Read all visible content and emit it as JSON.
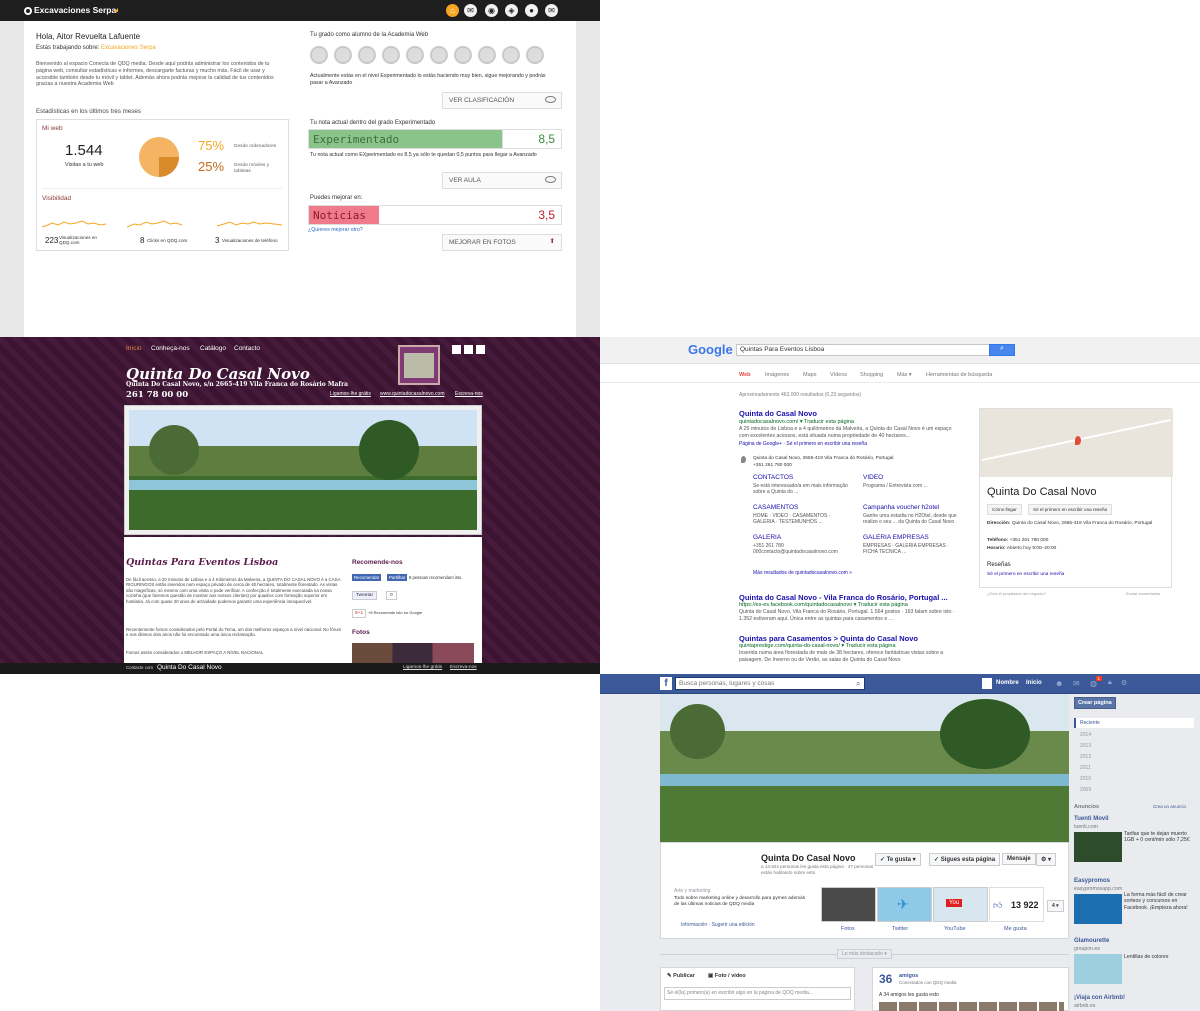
{
  "dash": {
    "brand": "Excavaciones Serpa",
    "greeting": "Hola, Aitor Revuelta Lafuente",
    "working_label": "Estás trabajando sobre:",
    "working_name": "Excavaciones Serpa",
    "intro": "Bienvenido al espacio Conecta de QDQ media. Desde aquí podrás administrar los contenidos de tu página web, consultar estadísticas e informes, descargarte facturas y mucho más. Fácil de usar y accesible también desde tu móvil y tablet. Además ahora podrás mejorar la calidad de tus contenidos gracias a nuestra Academia Web",
    "stats_title": "Estadísticas en los últimos tres meses",
    "my_web": "Mi web",
    "visits_value": "1.544",
    "visits_label": "Visitas a tu web",
    "pct_desktop": "75%",
    "pct_desktop_label": "Desde ordenadores",
    "pct_mobile": "25%",
    "pct_mobile_label": "Desde móviles y tabletas",
    "desktop_fraction": 0.75,
    "visibility": "Visibilidad",
    "vis_qdq_value": "223",
    "vis_qdq_label": "Visualizaciones en QDQ.com",
    "clicks_value": "8",
    "clicks_label": "Clicks en QDQ.com",
    "phone_views_value": "3",
    "phone_views_label": "Visualizaciones de teléfono",
    "academy_title": "Tu grado como alumno de la Academia Web",
    "academy_text": "Actualmente estás en el nivel Experimentado lo estás haciendo muy bien, sigue mejorando y podrás pasar a Avanzado",
    "ranking_btn": "VER CLASIFICACIÓN",
    "grade_title": "Tu nota actual dentro del grado Experimentado",
    "grade_label": "Experimentado",
    "grade_value": "8,5",
    "grade_fraction": 0.85,
    "grade_text": "Tu nota actual como EXperimentado es 8,5 ya sólo te quedan 0,5 puntos para llegar a Avanzado",
    "classroom_btn": "VER AULA",
    "improve_title": "Puedes mejorar en:",
    "improve_label": "Noticias",
    "improve_value": "3,5",
    "improve_fraction": 0.35,
    "improve_link": "¿Quieres mejorar otro?",
    "improve_btn": "MEJORAR EN FOTOS",
    "colors": {
      "green": "#8bc48a",
      "red": "#f07a8a",
      "orange": "#f5a623"
    }
  },
  "site": {
    "nav": [
      "Início",
      "Conheça-nos",
      "Catálogo",
      "Contacto"
    ],
    "title": "Quinta Do Casal Novo",
    "address": "Quinta Do Casal Novo, s/n  2665-419  Vila Franca do Rosário Mafra",
    "phone": "261 78 00 00",
    "links": [
      "Ligamos-lhe grátis",
      "www.quintadocasalnovo.com",
      "Escreva-nos"
    ],
    "heading": "Quintas Para Eventos Lisboa",
    "body1": "De fácil acesso, a 20 minutos de Lisboa e a 4 Kilómetros da Malveira, a QUINTA DO CASAL NOVO é a CASA RIGURINGOS estão inseridos num espaço privado de cerca de 40 hectares, totalmente florestado. As vistas são magníficas, só mesmo com uma visita o pode verificar. A confecção é totalmente executada na nossa cozinha (que fazemos questão de mostrar aos nossos clientes) por quadros com formação superior em hotelaria. Já com quase 20 anos de actividade podemos garantir uma experiência inesquecível.",
    "body2": "Recentemente fomos considerados pelo Portal do Tema, um dos melhores espaços a nível nacional. No fórum e nos últimos dois anos não foi encontrado uma única reclamação.",
    "body3": "Fomos assim considerados o MELHOR ESPAÇO A NÍVEL NACIONAL",
    "recommend_title": "Recomende-nos",
    "fb_recommend": "Recomendar",
    "fb_share": "Partilhar",
    "fb_count_text": "8 pessoas recomendam isto.",
    "tweet": "Tweetar",
    "tweet_count": "0",
    "gplus": "8+1",
    "gplus_text": "+8 Recomende isto no Google",
    "photos_title": "Fotos",
    "footer_left": "Contacte com",
    "footer_name": "Quinta Do Casal Novo",
    "footer_links": [
      "Ligamos-lhe grátis",
      "Escreva-nos"
    ]
  },
  "google": {
    "logo": "Google",
    "query": "Quintas Para Eventos Lisboa",
    "tabs": [
      "Web",
      "Imágenes",
      "Maps",
      "Vídeos",
      "Shopping",
      "Más ▾",
      "Herramientas de búsqueda"
    ],
    "results_count": "Aproximadamente 463.000 resultados (0,23 segundos)",
    "r1_title": "Quinta do Casal Novo",
    "r1_url": "quintadocasalnovo.com/ ▾  Traducir esta página",
    "r1_snip": "A 25 minutos de Lisboa e a 4 quilómetros da Malveira, a Quinta do Casal Novo é um espaço com excelentes acessos, está situada numa propriedade de 40 hectares...",
    "r1_gplus": "Página de Google+ · Sé el primero en escribir una reseña",
    "r1_addr": "Quinta do Casal Novo, 2665-419 Vila Franca do Rosário, Portugal",
    "r1_phone": "+351 261 780 000",
    "sitelinks": [
      {
        "t": "CONTACTOS",
        "s": "Se está interessado/a em mais informação sobre a Quinta do ..."
      },
      {
        "t": "VIDEO",
        "s": "Programa / Entrevista com ..."
      },
      {
        "t": "CASAMENTOS",
        "s": "HOME · VIDEO · CASAMENTOS · GALERIA · TESTEMUNHOS ..."
      },
      {
        "t": "Campanha voucher h2otel",
        "s": "Ganhe uma estadia no H2Otel, desde que realize o seu ... da Quinta do Casal Novo"
      },
      {
        "t": "GALERIA",
        "s": "+351 261 780 000contacto@quintadocasalnovo.com"
      },
      {
        "t": "GALERIA EMPRESAS",
        "s": "EMPRESAS · GALERIA EMPRESAS · FICHA TECNICA ..."
      }
    ],
    "more_results": "Más resultados de quintadocasalnovo.com »",
    "r2_title": "Quinta do Casal Novo - Vila Franca do Rosário, Portugal ...",
    "r2_url": "https://es-es.facebook.com/quintadocasalnovo ▾  Traducir esta página",
    "r2_snip": "Quinta do Casal Novo, Vila Franca do Rosário, Portugal. 1.564 gostos · 163 falam sobre isto · 1.352 estiveram aqui. Única entre as quintas para casamentos e ...",
    "r3_title": "Quintas para Casamentos > Quinta do Casal Novo",
    "r3_url": "quintaprestige.com/quinta-do-casal-novo/ ▾  Traducir esta página",
    "r3_snip": "Inserida numa área florestada de mais de 38 hectares, oferece fantásticas vistas sobre a paisagem. De Inverno ou de Verão, as salas de Quinta do Casal Novo",
    "kp_title": "Quinta Do Casal Novo",
    "kp_btn1": "Cómo llegar",
    "kp_btn2": "Sé el primero en escribir una reseña",
    "kp_addr_label": "Dirección:",
    "kp_addr": "Quinta do Casal Novo, 2665-419 Vila Franca do Rosário, Portugal",
    "kp_phone_label": "Teléfono:",
    "kp_phone": "+351 261 780 000",
    "kp_hours_label": "Horario:",
    "kp_hours": "Abierto hoy  9:00–20:00",
    "kp_reviews": "Reseñas",
    "kp_review_link": "Sé el primero en escribir una reseña",
    "kp_owner": "¿Eres el propietario del negocio?",
    "kp_comments": "Enviar comentarios"
  },
  "fb": {
    "search": "Busca personas, lugares y cosas",
    "user": "Nombre",
    "home": "Inicio",
    "notif": "1",
    "create_page": "Crear página",
    "years": [
      "Reciente",
      "2014",
      "2013",
      "2012",
      "2011",
      "2010",
      "2009"
    ],
    "page_name": "Quinta Do Casal Novo",
    "page_stats": "a 13.922 personas les gusta esta página · 47 personas están hablando sobre esto",
    "like_btn": "✓ Te gusta ▾",
    "follow_btn": "✓ Sigues esta página",
    "message_btn": "Mensaje",
    "category": "Arte y marketing",
    "about": "Todo sobre marketing online y desarrollo para pymes además de las últimas noticias de QDQ media",
    "info_link": "Información · Sugerir una edición",
    "thumbs": [
      "Fotos",
      "Twitter",
      "YouTube",
      "Me gusta"
    ],
    "likes_count": "13 922",
    "highlights": "Lo más destacado ▾",
    "publish": "Publicar",
    "photo_video": "Foto / vídeo",
    "post_placeholder": "Sé el(la) primero(a) en escribir algo en la página de QDQ media...",
    "friends_count": "36",
    "friends_label": "amigos",
    "friends_sub": "Conectados con QDQ media",
    "friends_like": "A 34 amigos les gusta esto",
    "ads_title": "Anuncios",
    "create_ad": "Crea un anuncio",
    "ads": [
      {
        "t": "Tuenti Movil",
        "u": "tuenti.com",
        "d": "Tarifas que te dejan muerto 1GB + 0 cent/min sólo 7,25€"
      },
      {
        "t": "Easypromos",
        "u": "easypromosapp.com",
        "d": "La forma más fácil de crear sorteos y concursos en Facebook. ¡Empieza ahora!"
      },
      {
        "t": "Glamourette",
        "u": "groupon.es",
        "d": "Lentillas de colores"
      },
      {
        "t": "¡Viaja con Airbnb!",
        "u": "airbnb.es",
        "d": ""
      }
    ]
  }
}
